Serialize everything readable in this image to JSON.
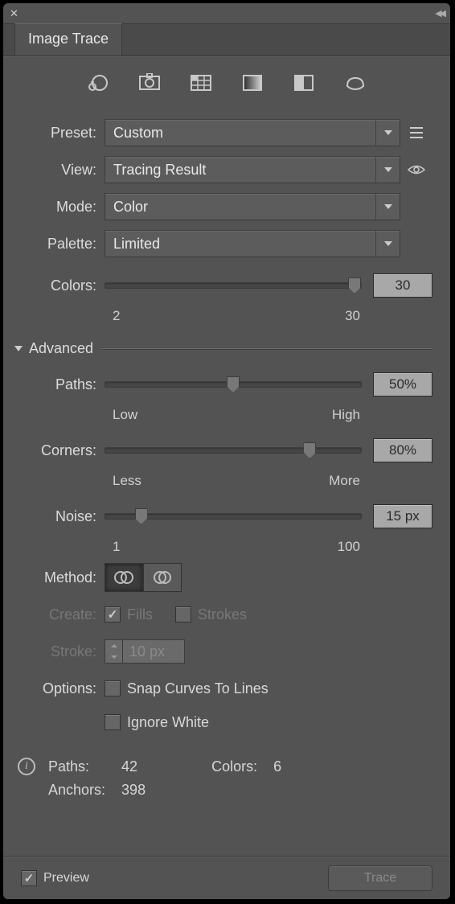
{
  "panel_title": "Image Trace",
  "preset": {
    "label": "Preset:",
    "value": "Custom"
  },
  "view": {
    "label": "View:",
    "value": "Tracing Result"
  },
  "mode": {
    "label": "Mode:",
    "value": "Color"
  },
  "palette": {
    "label": "Palette:",
    "value": "Limited"
  },
  "colors": {
    "label": "Colors:",
    "value": "30",
    "min": "2",
    "max": "30"
  },
  "advanced_label": "Advanced",
  "paths": {
    "label": "Paths:",
    "value": "50%",
    "lo": "Low",
    "hi": "High"
  },
  "corners": {
    "label": "Corners:",
    "value": "80%",
    "lo": "Less",
    "hi": "More"
  },
  "noise": {
    "label": "Noise:",
    "value": "15 px",
    "lo": "1",
    "hi": "100"
  },
  "method_label": "Method:",
  "create": {
    "label": "Create:",
    "fills": "Fills",
    "strokes": "Strokes"
  },
  "stroke": {
    "label": "Stroke:",
    "value": "10 px"
  },
  "options": {
    "label": "Options:",
    "snap": "Snap Curves To Lines",
    "ignore": "Ignore White"
  },
  "stats": {
    "paths_label": "Paths:",
    "paths_value": "42",
    "colors_label": "Colors:",
    "colors_value": "6",
    "anchors_label": "Anchors:",
    "anchors_value": "398"
  },
  "footer": {
    "preview": "Preview",
    "trace": "Trace"
  }
}
